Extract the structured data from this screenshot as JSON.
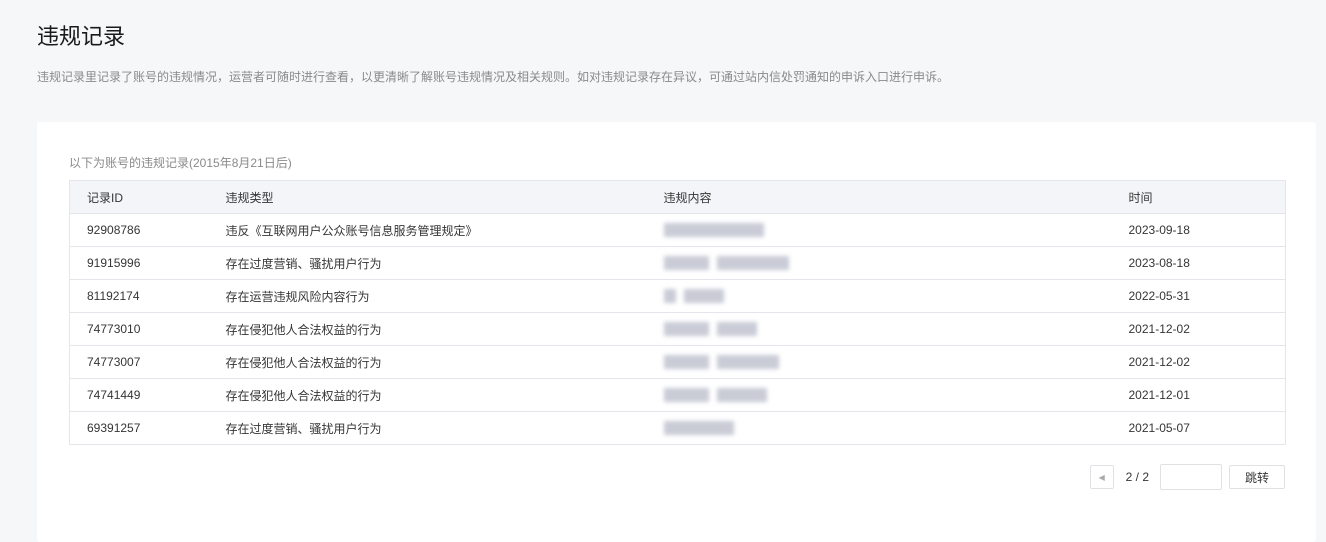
{
  "page": {
    "title": "违规记录",
    "description": "违规记录里记录了账号的违规情况，运营者可随时进行查看，以更清晰了解账号违规情况及相关规则。如对违规记录存在异议，可通过站内信处罚通知的申诉入口进行申诉。"
  },
  "records": {
    "caption": "以下为账号的违规记录(2015年8月21日后)",
    "columns": [
      "记录ID",
      "违规类型",
      "违规内容",
      "时间"
    ],
    "rows": [
      {
        "id": "92908786",
        "type": "违反《互联网用户公众账号信息服务管理规定》",
        "time": "2023-09-18"
      },
      {
        "id": "91915996",
        "type": "存在过度营销、骚扰用户行为",
        "time": "2023-08-18"
      },
      {
        "id": "81192174",
        "type": "存在运营违规风险内容行为",
        "time": "2022-05-31"
      },
      {
        "id": "74773010",
        "type": "存在侵犯他人合法权益的行为",
        "time": "2021-12-02"
      },
      {
        "id": "74773007",
        "type": "存在侵犯他人合法权益的行为",
        "time": "2021-12-02"
      },
      {
        "id": "74741449",
        "type": "存在侵犯他人合法权益的行为",
        "time": "2021-12-01"
      },
      {
        "id": "69391257",
        "type": "存在过度营销、骚扰用户行为",
        "time": "2021-05-07"
      }
    ]
  },
  "pagination": {
    "page_info": "2 / 2",
    "jump_label": "跳转",
    "jump_value": ""
  }
}
